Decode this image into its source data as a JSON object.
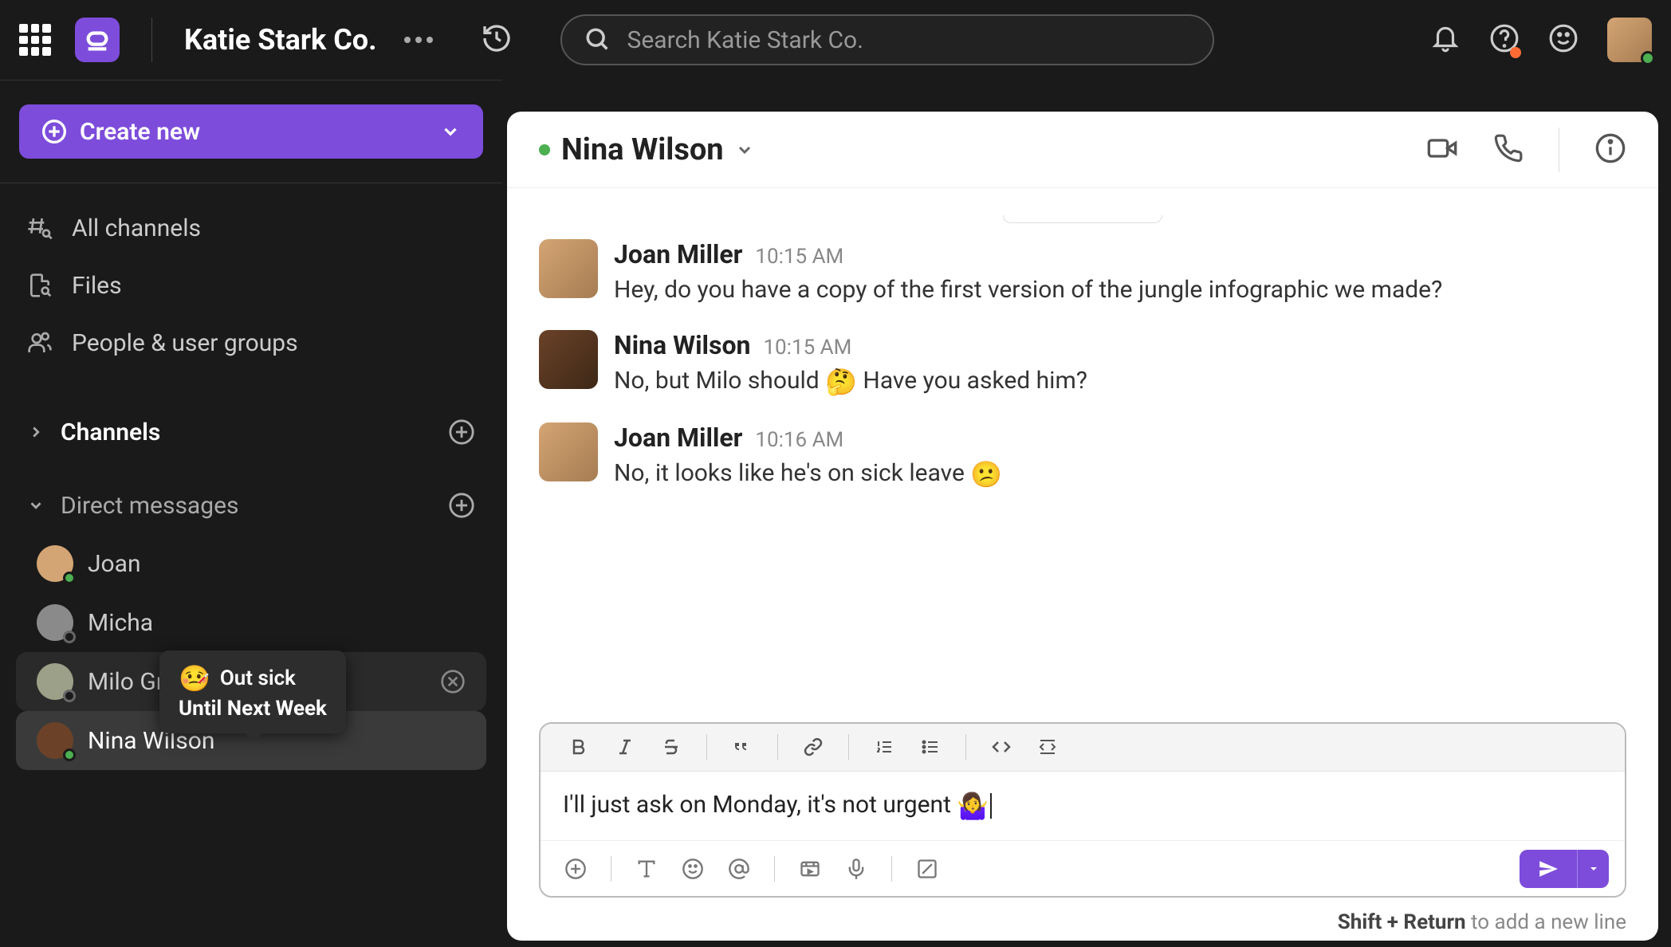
{
  "workspace": {
    "name": "Katie Stark Co."
  },
  "search": {
    "placeholder": "Search Katie Stark Co."
  },
  "sidebar": {
    "create_label": "Create new",
    "nav": {
      "all_channels": "All channels",
      "files": "Files",
      "people": "People & user groups"
    },
    "sections": {
      "channels": "Channels",
      "dms": "Direct messages"
    },
    "dms": [
      {
        "name": "Joan",
        "presence": "online",
        "avatar_bg": "#d4a574"
      },
      {
        "name": "Micha",
        "presence": "offline",
        "avatar_bg": "#8a8a8a"
      },
      {
        "name": "Milo Green",
        "presence": "offline",
        "avatar_bg": "#9ca088",
        "status_emoji": "🤒"
      },
      {
        "name": "Nina Wilson",
        "presence": "online",
        "avatar_bg": "#6b4228"
      }
    ]
  },
  "tooltip": {
    "emoji": "🤒",
    "line1": "Out sick",
    "line2": "Until Next Week"
  },
  "chat": {
    "title": "Nina Wilson",
    "presence": "online",
    "messages": [
      {
        "author": "Joan Miller",
        "time": "10:15 AM",
        "avatar_bg": "#d4a574",
        "text": "Hey, do you have a copy of the first version of the jungle infographic we made?"
      },
      {
        "author": "Nina Wilson",
        "time": "10:15 AM",
        "avatar_bg": "#6b4228",
        "text_pre": "No, but Milo should ",
        "emoji": "🤔",
        "text_post": " Have you asked him?"
      },
      {
        "author": "Joan Miller",
        "time": "10:16 AM",
        "avatar_bg": "#d4a574",
        "text_pre": "No, it looks like he's on sick leave ",
        "emoji": "😕",
        "text_post": ""
      }
    ]
  },
  "composer": {
    "draft_pre": "I'll just ask on Monday, it's not urgent ",
    "draft_emoji": "🤷‍♀️"
  },
  "hint": {
    "bold": "Shift + Return",
    "rest": " to add a new line"
  }
}
